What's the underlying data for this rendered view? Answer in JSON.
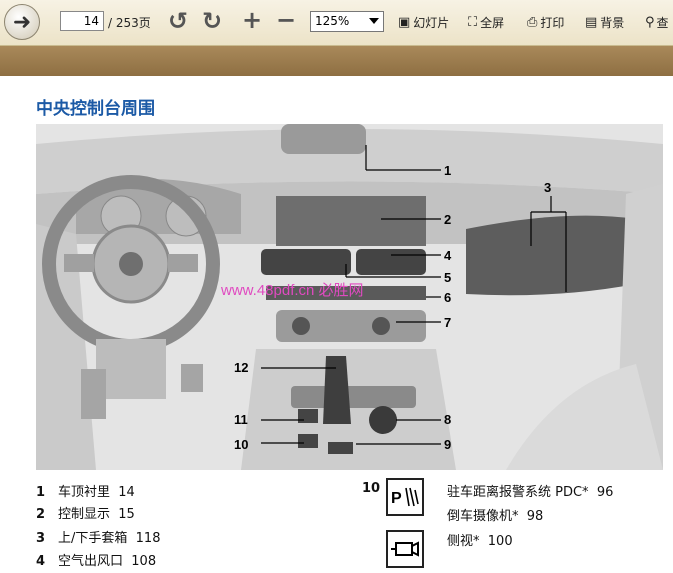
{
  "toolbar": {
    "page_current": "14",
    "page_total": "/ 253页",
    "zoom": "125%",
    "slideshow": "幻灯片",
    "fullscreen": "全屏",
    "print": "打印",
    "background": "背景",
    "search": "查"
  },
  "doc": {
    "title": "中央控制台周围",
    "watermark": "www.48pdf.cn 必胜网",
    "callouts": [
      "1",
      "2",
      "3",
      "4",
      "5",
      "6",
      "7",
      "8",
      "9",
      "10",
      "11",
      "12"
    ],
    "legend": [
      {
        "num": "1",
        "label": "车顶衬里",
        "page": "14"
      },
      {
        "num": "2",
        "label": "控制显示",
        "page": "15"
      },
      {
        "num": "3",
        "label": "上/下手套箱",
        "page": "118"
      },
      {
        "num": "4",
        "label": "空气出风口",
        "page": "108"
      }
    ],
    "legend_10": {
      "num": "10",
      "items": [
        {
          "label": "驻车距离报警系统 PDC*",
          "page": "96"
        },
        {
          "label": "倒车摄像机*",
          "page": "98"
        },
        {
          "label": "侧视*",
          "page": "100"
        }
      ]
    }
  },
  "icons": [
    "back-arrow-icon",
    "rotate-left-icon",
    "rotate-right-icon",
    "zoom-in-icon",
    "zoom-out-icon",
    "slideshow-icon",
    "fullscreen-icon",
    "print-icon",
    "background-icon",
    "search-icon",
    "pdc-icon",
    "side-view-camera-icon"
  ]
}
